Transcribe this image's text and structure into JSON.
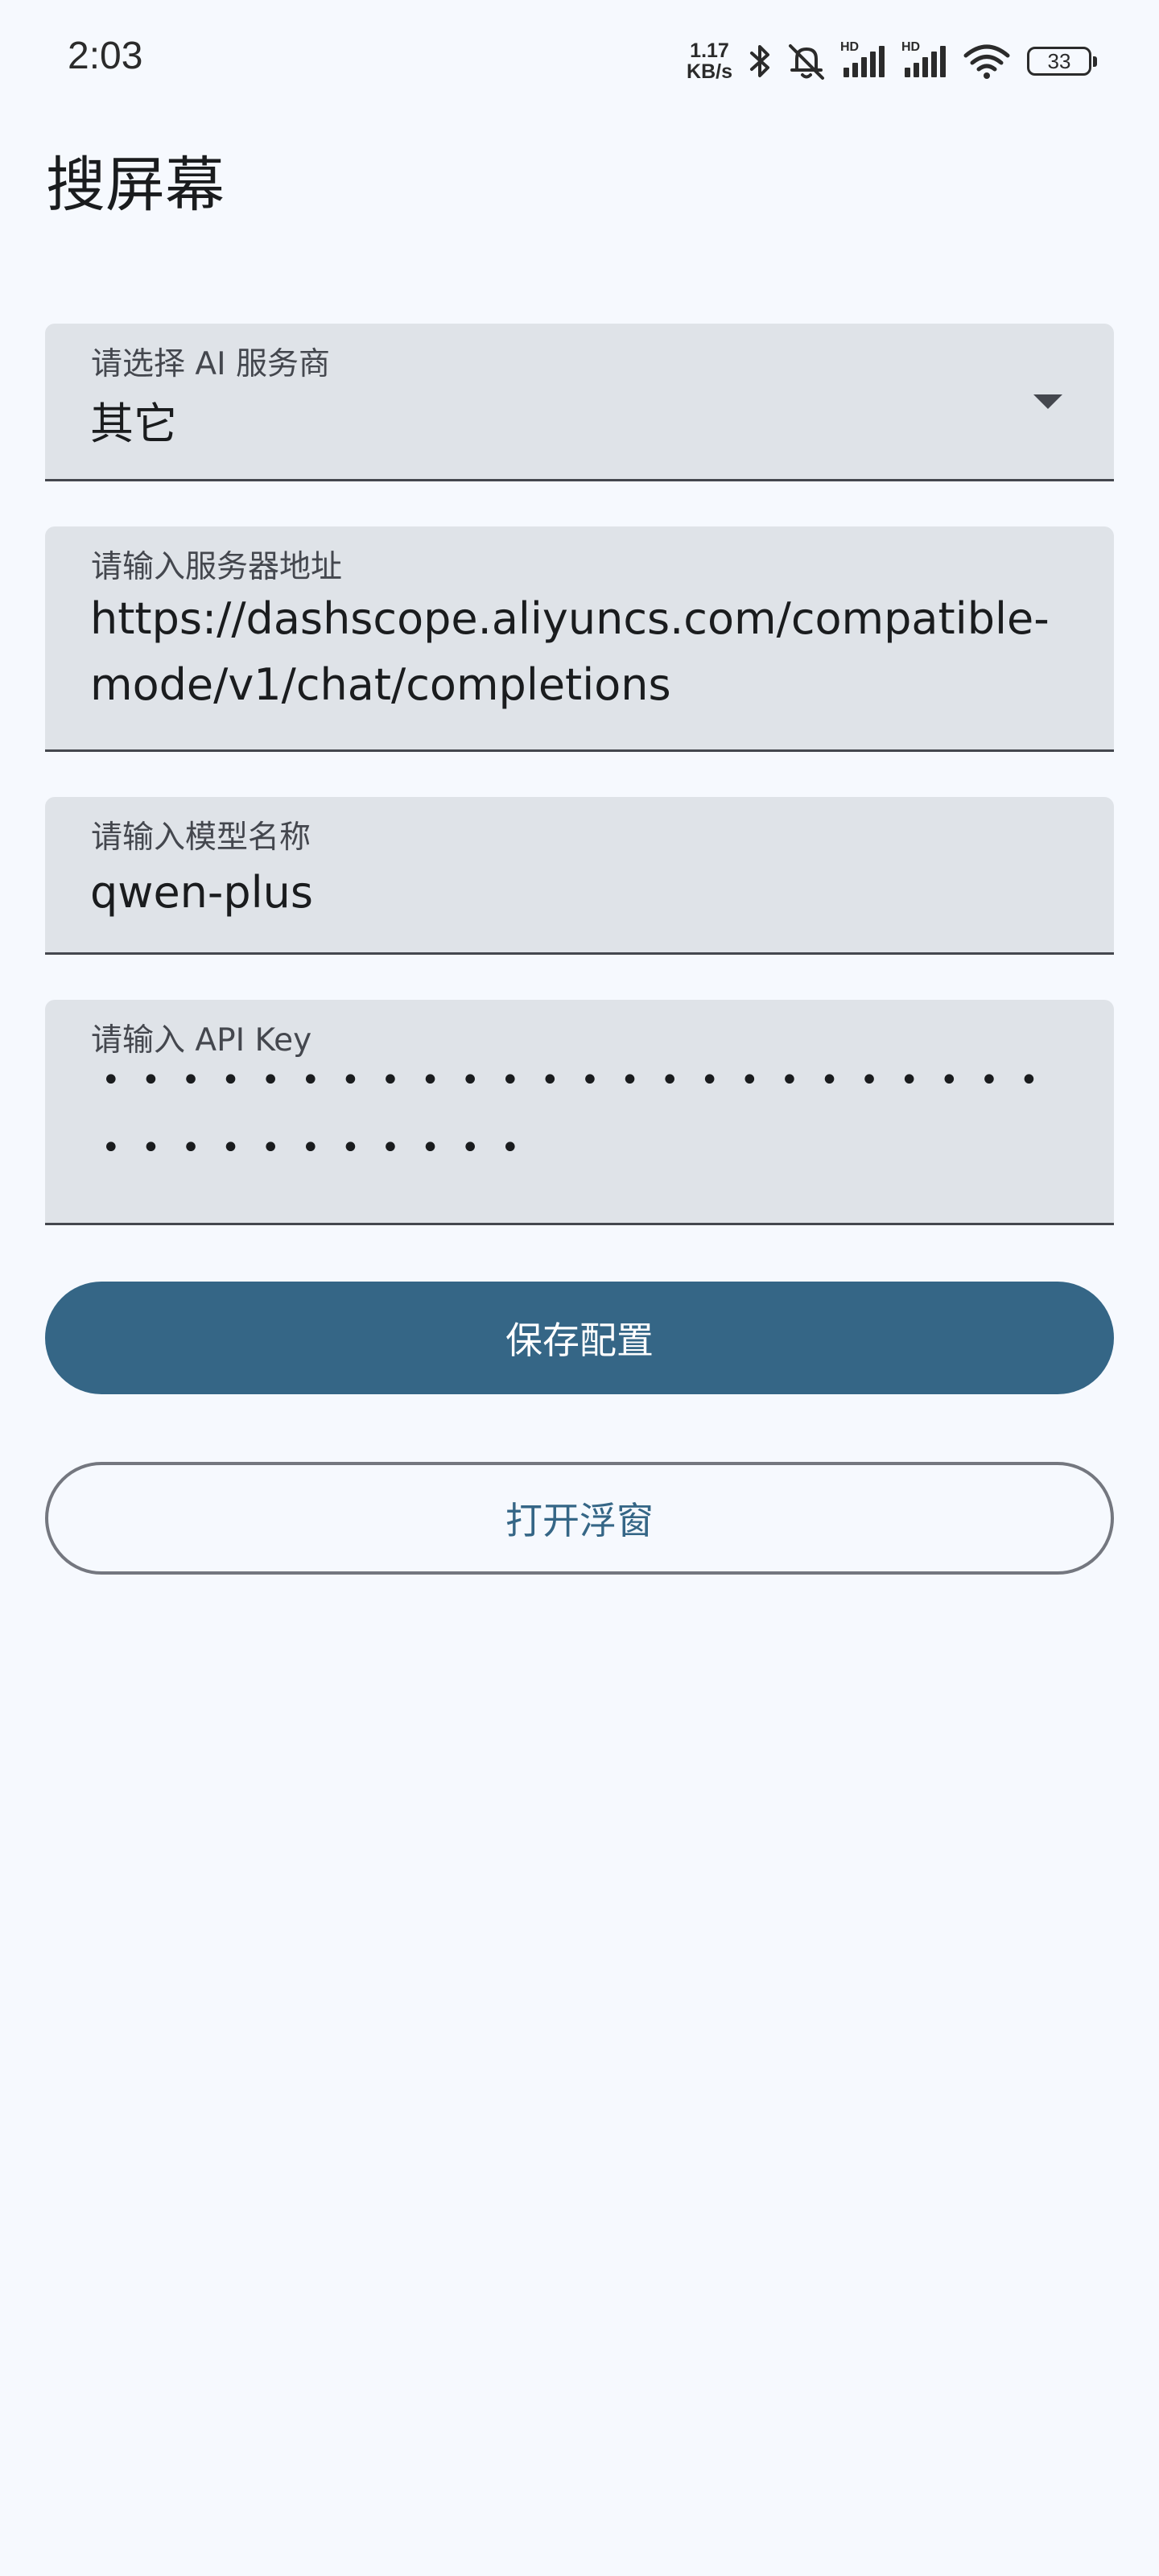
{
  "status_bar": {
    "time": "2:03",
    "net_speed_value": "1.17",
    "net_speed_unit": "KB/s",
    "hd_label_1": "HD",
    "hd_label_2": "HD",
    "battery": "33",
    "icons": [
      "bluetooth-icon",
      "mute-icon",
      "signal-icon",
      "signal-icon",
      "wifi-icon",
      "battery-icon"
    ]
  },
  "page": {
    "title": "搜屏幕"
  },
  "form": {
    "provider": {
      "label": "请选择 AI 服务商",
      "value": "其它"
    },
    "server_url": {
      "label": "请输入服务器地址",
      "value": "https://dashscope.aliyuncs.com/compatible-mode/v1/chat/completions"
    },
    "model": {
      "label": "请输入模型名称",
      "value": "qwen-plus"
    },
    "api_key": {
      "label": "请输入 API Key",
      "masked_value": "•••••••••••••••••••••••••••••••••••"
    }
  },
  "buttons": {
    "save": "保存配置",
    "open_float": "打开浮窗"
  },
  "colors": {
    "background": "#f6f9fe",
    "field_bg": "#dfe3e8",
    "primary": "#356686"
  }
}
